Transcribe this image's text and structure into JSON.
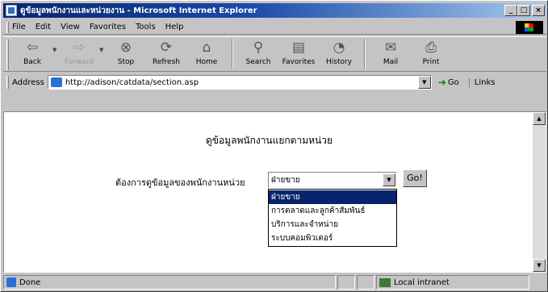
{
  "window": {
    "title": "ดูข้อมูลพนักงานและหน่วยงาน - Microsoft Internet Explorer",
    "minimize": "_",
    "maximize": "□",
    "close": "×"
  },
  "menu": [
    "File",
    "Edit",
    "View",
    "Favorites",
    "Tools",
    "Help"
  ],
  "toolbar": {
    "back": "Back",
    "forward": "Forward",
    "stop": "Stop",
    "refresh": "Refresh",
    "home": "Home",
    "search": "Search",
    "favorites": "Favorites",
    "history": "History",
    "mail": "Mail",
    "print": "Print"
  },
  "address": {
    "label": "Address",
    "value": "http://adison/catdata/section.asp",
    "go": "Go",
    "links": "Links"
  },
  "page": {
    "heading": "ดูข้อมูลพนักงานแยกตามหน่วย",
    "form_label": "ต้องการดูข้อมูลของพนักงานหน่วย",
    "select_value": "ฝ่ายขาย",
    "options": [
      "ฝ่ายขาย",
      "การตลาดและลูกค้าสัมพันธ์",
      "บริการและจำหน่าย",
      "ระบบคอมพิวเตอร์"
    ],
    "go_button": "Go!"
  },
  "status": {
    "text": "Done",
    "zone": "Local intranet"
  }
}
